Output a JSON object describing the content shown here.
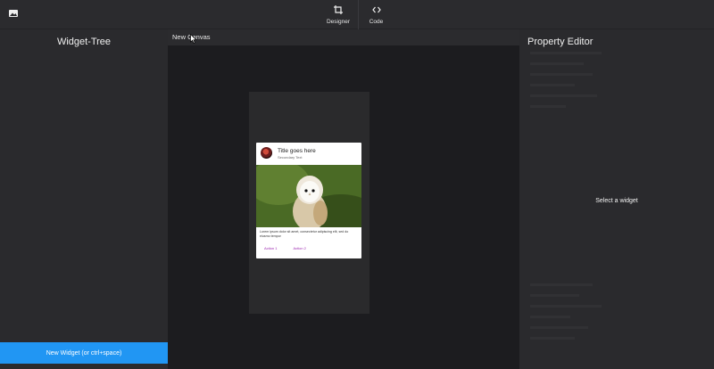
{
  "toolbar": {
    "app_icon": "image-icon",
    "designer_label": "Designer",
    "designer_icon": "crop-icon",
    "code_label": "Code",
    "code_icon": "code-brackets-icon"
  },
  "left_panel": {
    "title": "Widget-Tree",
    "new_widget_label": "New Widget (or ctrl+space)"
  },
  "canvas": {
    "name": "New Canvas"
  },
  "card": {
    "title": "Title goes here",
    "subtitle": "Secondary Text",
    "body": "Lorem ipsum dolor sit amet, consectetur adipiscing elit, sed do eiusmo tempor",
    "action1": "Action 1",
    "action2": "Action 2"
  },
  "right_panel": {
    "title": "Property Editor",
    "empty_text": "Select a widget"
  },
  "colors": {
    "accent": "#2196f3",
    "card_action": "#9c27b0"
  }
}
